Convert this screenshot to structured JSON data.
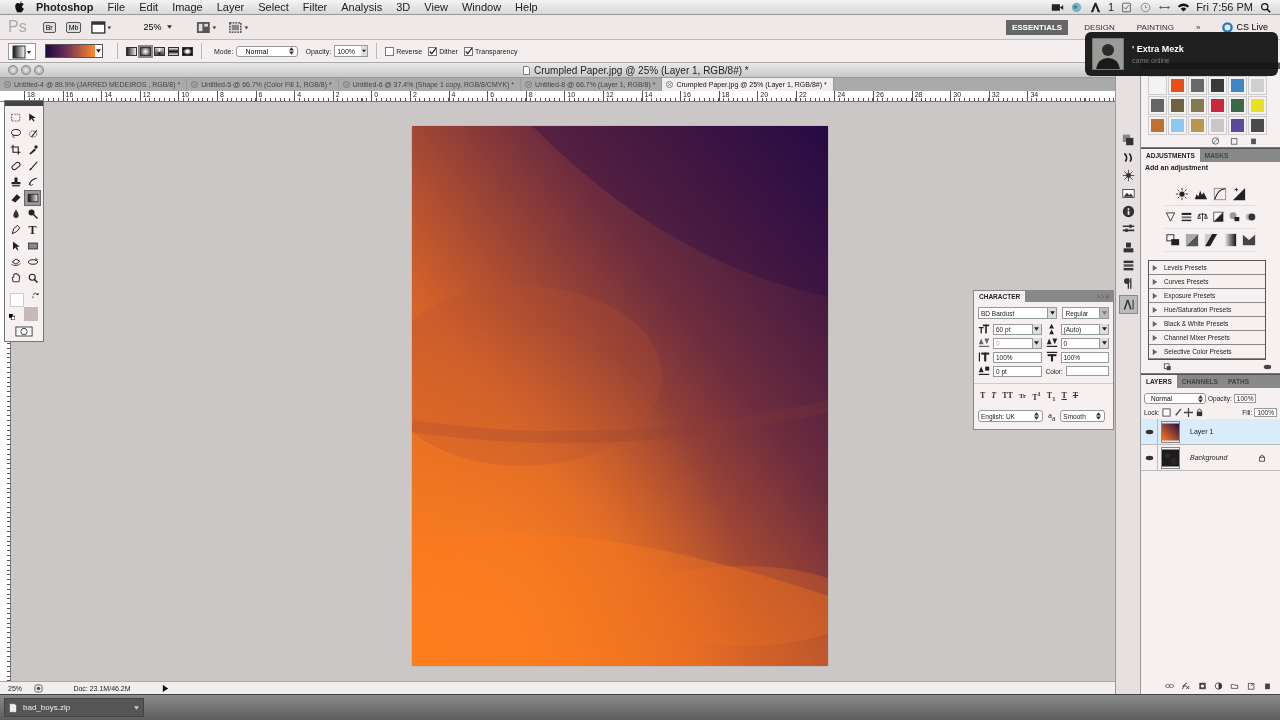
{
  "menu_bar": {
    "app": "Photoshop",
    "items": [
      "File",
      "Edit",
      "Image",
      "Layer",
      "Select",
      "Filter",
      "Analysis",
      "3D",
      "View",
      "Window",
      "Help"
    ],
    "adobe_count": "1",
    "clock": "Fri 7:56 PM"
  },
  "app_bar": {
    "logo": "Ps",
    "bridge": "Br",
    "mini_bridge": "Mb",
    "zoom": "25%",
    "workspaces": [
      {
        "label": "ESSENTIALS",
        "selected": true
      },
      {
        "label": "DESIGN",
        "selected": false
      },
      {
        "label": "PAINTING",
        "selected": false
      }
    ],
    "more": "»",
    "cs_live": "CS Live"
  },
  "options_bar": {
    "gradient_types": [
      {
        "kind": "linear",
        "selected": false
      },
      {
        "kind": "radial",
        "selected": true
      },
      {
        "kind": "angle",
        "selected": false
      },
      {
        "kind": "reflected",
        "selected": false
      },
      {
        "kind": "diamond",
        "selected": false
      }
    ],
    "mode_label": "Mode:",
    "mode": "Normal",
    "opacity_label": "Opacity:",
    "opacity": "100%",
    "checkboxes": [
      {
        "label": "Reverse",
        "checked": false
      },
      {
        "label": "Dither",
        "checked": true
      },
      {
        "label": "Transparency",
        "checked": true
      }
    ]
  },
  "document": {
    "title": "Crumpled Paper.jpg @ 25% (Layer 1, RGB/8#) *",
    "tabs": [
      {
        "label": "Untitled-4 @ 89.9% (JARRED MEDEIROS , RGB/8) *",
        "selected": false
      },
      {
        "label": "Untitled-5 @ 66.7% (Color Fill 1, RGB/8) *",
        "selected": false
      },
      {
        "label": "Untitled-6 @ 37.4% (Shape 1 copy, RGB/8/CMYK) *",
        "selected": false
      },
      {
        "label": "Untitled-8 @ 66.7% (Layer 1, RGB/8) *",
        "selected": false
      },
      {
        "label": "Crumpled Paper.jpg @ 25% (Layer 1, RGB/8#) *",
        "selected": true
      }
    ],
    "ruler": [
      "18",
      "16",
      "14",
      "12",
      "10",
      "8",
      "6",
      "4",
      "2",
      "0",
      "2",
      "4",
      "6",
      "8",
      "10",
      "12",
      "14",
      "16",
      "18",
      "20",
      "22",
      "24",
      "26",
      "28",
      "30",
      "32",
      "34"
    ],
    "zoom": "25%",
    "doc_size": "Doc: 23.1M/46.2M"
  },
  "tools": [
    {
      "kind": "marquee",
      "selected": false
    },
    {
      "kind": "move",
      "selected": false
    },
    {
      "kind": "lasso",
      "selected": false
    },
    {
      "kind": "quickselect",
      "selected": false
    },
    {
      "kind": "crop",
      "selected": false
    },
    {
      "kind": "eyedropper",
      "selected": false
    },
    {
      "kind": "healing",
      "selected": false
    },
    {
      "kind": "brush",
      "selected": false
    },
    {
      "kind": "stamp",
      "selected": false
    },
    {
      "kind": "historybrush",
      "selected": false
    },
    {
      "kind": "eraser",
      "selected": false
    },
    {
      "kind": "gradient",
      "selected": true
    },
    {
      "kind": "blur",
      "selected": false
    },
    {
      "kind": "dodge",
      "selected": false
    },
    {
      "kind": "pen",
      "selected": false
    },
    {
      "kind": "type",
      "selected": false,
      "label": "T"
    },
    {
      "kind": "pathselect",
      "selected": false
    },
    {
      "kind": "shape",
      "selected": false
    },
    {
      "kind": "rotate3d",
      "selected": false
    },
    {
      "kind": "orbit3d",
      "selected": false
    },
    {
      "kind": "hand",
      "selected": false
    },
    {
      "kind": "zoom",
      "selected": false
    }
  ],
  "notification": {
    "title": "' Extra Mezk",
    "message": "came online"
  },
  "swatches": [
    {
      "color": "#f4f4f4"
    },
    {
      "color": "#e8501a"
    },
    {
      "color": "#6a6a6a"
    },
    {
      "color": "#3a3a3a"
    },
    {
      "color": "#3e86c6"
    },
    {
      "color": "#cfcfcf"
    },
    {
      "color": "#666666"
    },
    {
      "color": "#6e6244"
    },
    {
      "color": "#837a4f"
    },
    {
      "color": "#c8283c"
    },
    {
      "color": "#3a6a4a"
    },
    {
      "color": "#e8e020"
    },
    {
      "color": "#c07030"
    },
    {
      "color": "#8cc8f0"
    },
    {
      "color": "#b89850"
    },
    {
      "color": "#c8c8c8"
    },
    {
      "color": "#5a4a9a"
    },
    {
      "color": "#4a4a4a"
    }
  ],
  "adjustments": {
    "tabs": [
      {
        "label": "ADJUSTMENTS",
        "selected": true
      },
      {
        "label": "MASKS",
        "selected": false
      }
    ],
    "heading": "Add an adjustment",
    "presets": [
      {
        "label": "Levels Presets",
        "expanded": false
      },
      {
        "label": "Curves Presets",
        "expanded": false
      },
      {
        "label": "Exposure Presets",
        "expanded": false
      },
      {
        "label": "Hue/Saturation Presets",
        "expanded": false
      },
      {
        "label": "Black & White Presets",
        "expanded": false
      },
      {
        "label": "Channel Mixer Presets",
        "expanded": false
      },
      {
        "label": "Selective Color Presets",
        "expanded": false
      }
    ]
  },
  "character": {
    "title": "CHARACTER",
    "font": "BD Bardust",
    "style": "Regular",
    "fields": [
      {
        "kind": "size",
        "value": "60 pt",
        "disabled": false
      },
      {
        "kind": "leading",
        "value": "(Auto)",
        "disabled": false
      },
      {
        "kind": "kerning",
        "value": "0",
        "disabled": true
      },
      {
        "kind": "tracking",
        "value": "0",
        "disabled": false
      },
      {
        "kind": "vscale",
        "value": "100%",
        "disabled": false
      },
      {
        "kind": "hscale",
        "value": "100%",
        "disabled": false
      },
      {
        "kind": "baseline",
        "value": "0 pt",
        "disabled": false
      }
    ],
    "color_label": "Color:",
    "style_buttons": [
      {
        "label": "T",
        "kind": "bold"
      },
      {
        "label": "T",
        "kind": "italic"
      },
      {
        "label": "TT",
        "kind": "caps"
      },
      {
        "label": "Tr",
        "kind": "smallcaps"
      },
      {
        "label": "T$^{1}$",
        "kind": "super"
      },
      {
        "label": "T$_{1}$",
        "kind": "sub"
      },
      {
        "label": "T",
        "kind": "underline"
      },
      {
        "label": "T",
        "kind": "strike"
      }
    ],
    "language": "English: UK",
    "antialias_label": "a$_{a}$",
    "antialias": "Smooth"
  },
  "layers": {
    "tabs": [
      {
        "label": "LAYERS",
        "selected": true
      },
      {
        "label": "CHANNELS",
        "selected": false
      },
      {
        "label": "PATHS",
        "selected": false
      }
    ],
    "blend": "Normal",
    "opacity_label": "Opacity:",
    "opacity": "100%",
    "lock_label": "Lock:",
    "fill_label": "Fill:",
    "fill": "100%",
    "items": [
      {
        "name": "Layer 1",
        "kind": "gradient",
        "selected": true,
        "visible": true,
        "locked": false
      },
      {
        "name": "Background",
        "kind": "dark",
        "selected": false,
        "visible": true,
        "locked": true
      }
    ]
  },
  "dock": {
    "download": "bad_boys.zip"
  }
}
